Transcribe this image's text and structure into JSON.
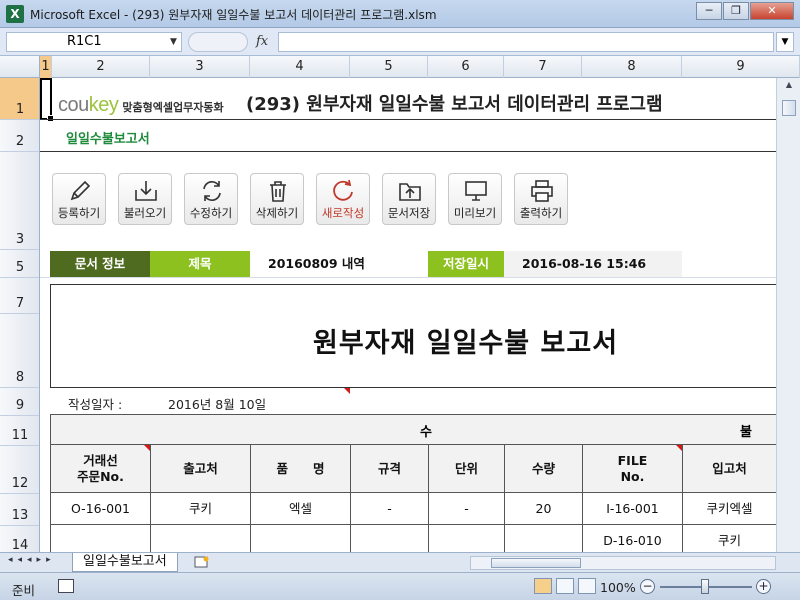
{
  "window": {
    "app_logo": "X",
    "title": "Microsoft Excel - (293) 원부자재 일일수불 보고서 데이터관리 프로그램.xlsm",
    "buttons": {
      "minimize": "─",
      "restore": "❐",
      "close": "✕"
    }
  },
  "formula_bar": {
    "name_box": "R1C1",
    "fx": "fx",
    "value": ""
  },
  "column_headers": [
    "1",
    "2",
    "3",
    "4",
    "5",
    "6",
    "7",
    "8",
    "9"
  ],
  "row_headers": [
    "1",
    "2",
    "3",
    "5",
    "7",
    "8",
    "9",
    "11",
    "12",
    "13",
    "14"
  ],
  "sheet": {
    "brand": {
      "name_a": "cou",
      "name_b": "key",
      "tagline": "맞춤형엑셀업무자동화"
    },
    "header_title": "(293) 원부자재 일일수불 보고서 데이터관리 프로그램",
    "subtitle": "일일수불보고서",
    "toolbar": [
      {
        "label": "등록하기",
        "icon": "pencil-icon"
      },
      {
        "label": "불러오기",
        "icon": "tray-download-icon"
      },
      {
        "label": "수정하기",
        "icon": "refresh-icon"
      },
      {
        "label": "삭제하기",
        "icon": "trash-icon"
      },
      {
        "label": "새로작성",
        "icon": "circular-arrow-icon"
      },
      {
        "label": "문서저장",
        "icon": "folder-upload-icon"
      },
      {
        "label": "미리보기",
        "icon": "monitor-icon"
      },
      {
        "label": "출력하기",
        "icon": "printer-icon"
      }
    ],
    "info": {
      "doc_info_label": "문서 정보",
      "title_label": "제목",
      "title_value": "20160809 내역",
      "saved_label": "저장일시",
      "saved_value": "2016-08-16 15:46"
    },
    "report_title": "원부자재 일일수불 보고서",
    "date_label": "작성일자 :",
    "date_value": "2016년 8월 10일",
    "table": {
      "group_in": "수",
      "group_out": "불",
      "headers": [
        "거래선\n주문No.",
        "출고처",
        "품　　명",
        "규격",
        "단위",
        "수량",
        "FILE\nNo.",
        "입고처"
      ],
      "rows": [
        [
          "O-16-001",
          "쿠키",
          "엑셀",
          "-",
          "-",
          "20",
          "I-16-001",
          "쿠키엑셀"
        ],
        [
          "",
          "",
          "",
          "",
          "",
          "",
          "D-16-010",
          "쿠키"
        ]
      ]
    }
  },
  "tabs": {
    "nav": "◂◂◂▸▸",
    "sheet_name": "일일수불보고서"
  },
  "status": {
    "ready": "준비",
    "zoom": "100%"
  },
  "colors": {
    "accent_green": "#8cc11f",
    "dark_green": "#4f6b1f",
    "red": "#d01b1b"
  }
}
